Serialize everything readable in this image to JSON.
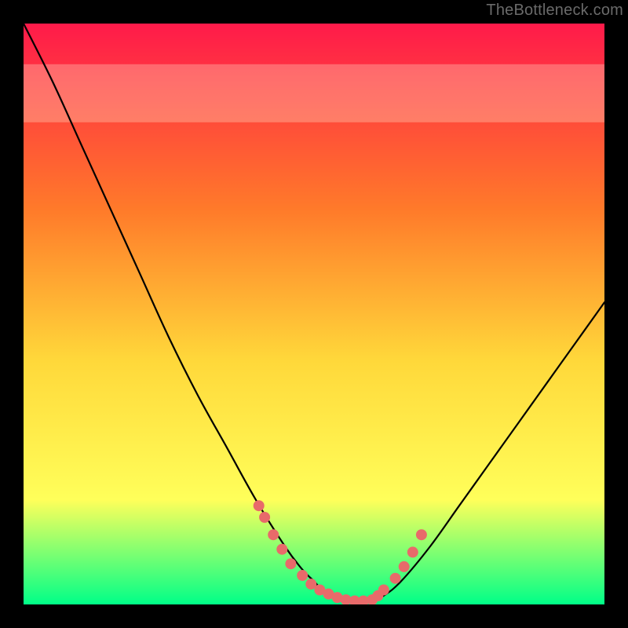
{
  "watermark": "TheBottleneck.com",
  "chart_data": {
    "type": "line",
    "title": "",
    "xlabel": "",
    "ylabel": "",
    "xlim": [
      0,
      100
    ],
    "ylim": [
      0,
      100
    ],
    "series": [
      {
        "name": "bottleneck-curve",
        "x": [
          0,
          5,
          10,
          15,
          20,
          25,
          30,
          35,
          40,
          45,
          48,
          50,
          52,
          55,
          58,
          60,
          62,
          65,
          70,
          75,
          80,
          85,
          90,
          95,
          100
        ],
        "y": [
          100,
          90,
          79,
          68,
          57,
          46,
          36,
          27,
          18,
          10,
          6,
          4,
          2,
          1,
          0.5,
          0.5,
          1.5,
          4,
          10,
          17,
          24,
          31,
          38,
          45,
          52
        ]
      }
    ],
    "markers": {
      "name": "curve-markers",
      "color": "#e86a6a",
      "radius": 7,
      "x": [
        40.5,
        41.5,
        43,
        44.5,
        46,
        48,
        49.5,
        51,
        52.5,
        54,
        55.5,
        57,
        58.5,
        60,
        61,
        62,
        64,
        65.5,
        67,
        68.5
      ],
      "y": [
        17,
        15,
        12,
        9.5,
        7,
        5,
        3.5,
        2.5,
        1.8,
        1.2,
        0.8,
        0.6,
        0.6,
        0.8,
        1.5,
        2.5,
        4.5,
        6.5,
        9,
        12
      ]
    },
    "background_gradient": {
      "top": "#ff1a4a",
      "upper_mid": "#ff7a2a",
      "mid": "#ffd83a",
      "lower_mid": "#ffff5a",
      "bottom": "#00ff88"
    },
    "highlight_band": {
      "y_from": 83,
      "y_to": 93,
      "opacity": 0.28,
      "color": "#ffffe0"
    }
  }
}
